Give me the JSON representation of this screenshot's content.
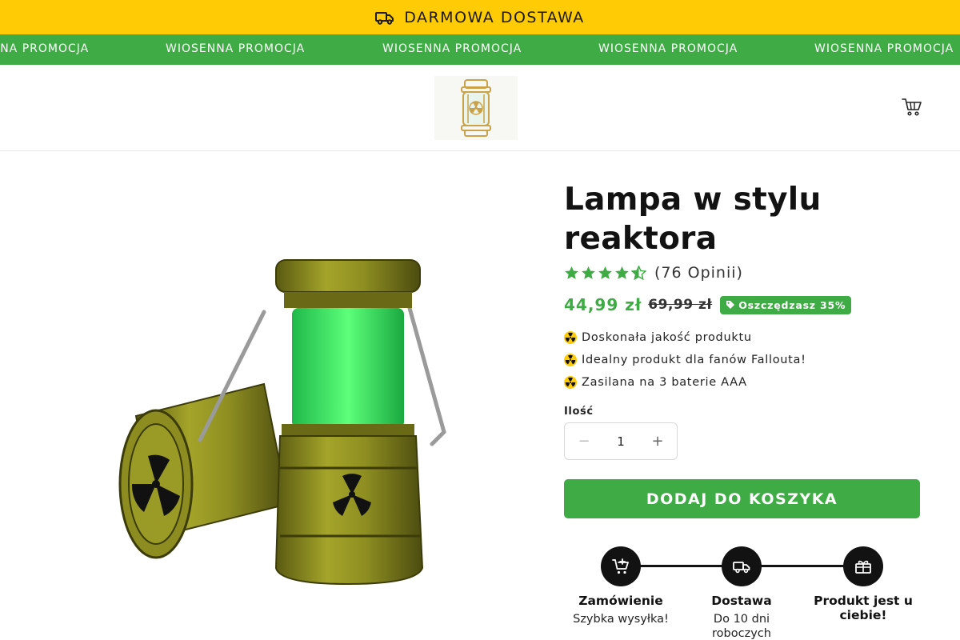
{
  "announcement": {
    "text": "DARMOWA DOSTAWA",
    "icon": "truck-icon"
  },
  "marquee": {
    "items": [
      "WIOSENNA PROMOCJA",
      "WIOSENNA PROMOCJA",
      "WIOSENNA PROMOCJA",
      "WIOSENNA PROMOCJA",
      "WIOSENNA PROMOCJA"
    ]
  },
  "header": {
    "logo": "reactor-lamp-logo",
    "cart_icon": "cart-icon"
  },
  "product": {
    "title": "Lampa w stylu reaktora",
    "rating": {
      "stars": 4.5,
      "text": "(76 Opinii)"
    },
    "price_sale": "44,99 zł",
    "price_regular": "69,99 zł",
    "savings_badge": "Oszczędzasz 35%",
    "features": [
      {
        "text": "Doskonała jakość produktu",
        "icon": "radiation-icon"
      },
      {
        "text": "Idealny produkt dla fanów Fallouta!",
        "icon": "radiation-icon"
      },
      {
        "text": "Zasilana na 3 baterie AAA",
        "icon": "radiation-icon"
      }
    ],
    "quantity_label": "Ilość",
    "quantity": "1",
    "add_to_cart": "DODAJ DO KOSZYKA"
  },
  "steps": [
    {
      "title": "Zamówienie",
      "subtitle": "Szybka wysyłka!",
      "icon": "cart-plus-icon"
    },
    {
      "title": "Dostawa",
      "subtitle": "Do 10 dni roboczych",
      "icon": "truck-icon"
    },
    {
      "title": "Produkt jest u ciebie!",
      "subtitle": "",
      "icon": "gift-icon"
    }
  ],
  "colors": {
    "announcement_bg": "#ffcb05",
    "brand_green": "#3fab45",
    "text_dark": "#121212"
  }
}
